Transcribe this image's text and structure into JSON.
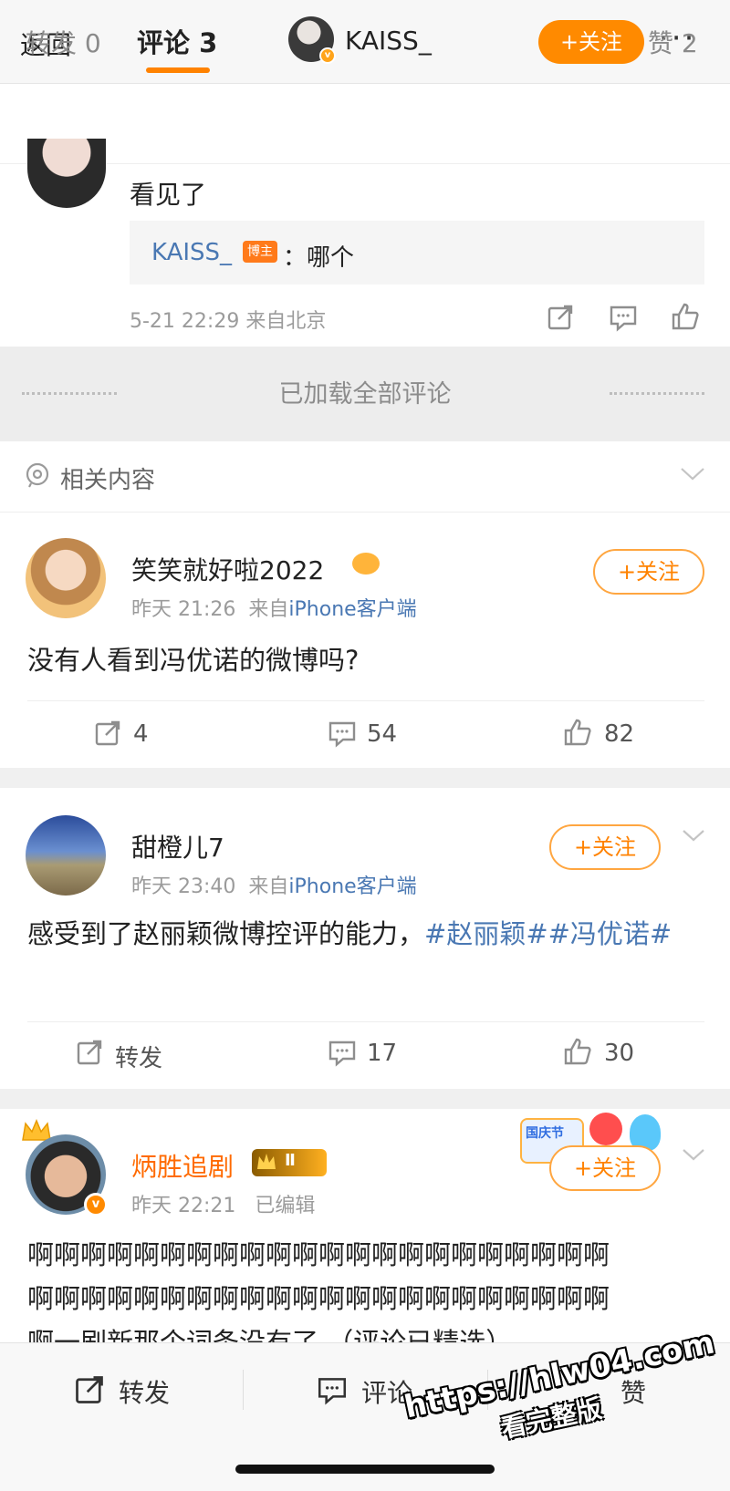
{
  "nav": {
    "back_label": "返回",
    "username": "KAISS_",
    "follow_label": "+关注",
    "more_label": "···"
  },
  "tabs": {
    "repost_label": "转发",
    "repost_count": "0",
    "comment_label": "评论",
    "comment_count": "3",
    "like_label": "赞",
    "like_count": "2"
  },
  "top_comment": {
    "text": "看见了",
    "reply_author": "KAISS_",
    "reply_tag": "博主",
    "reply_text": "：哪个",
    "meta": "5-21 22:29  来自北京"
  },
  "loaded_all": "已加载全部评论",
  "related_title": "相关内容",
  "posts": [
    {
      "author": "笑笑就好啦2022",
      "time": "昨天 21:26",
      "source_prefix": "来自",
      "source": "iPhone客户端",
      "follow_label": "+关注",
      "text": "没有人看到冯优诺的微博吗?",
      "repost": "4",
      "comments": "54",
      "likes": "82"
    },
    {
      "author": "甜橙儿7",
      "time": "昨天 23:40",
      "source_prefix": "来自",
      "source": "iPhone客户端",
      "follow_label": "+关注",
      "text": "感受到了赵丽颖微博控评的能力，",
      "topic1": "#赵丽颖#",
      "topic2": "#冯优诺#",
      "repost": "转发",
      "comments": "17",
      "likes": "30"
    },
    {
      "author": "炳胜追剧",
      "level": "Ⅱ",
      "time": "昨天 22:21",
      "edited": "已编辑",
      "follow_label": "+关注",
      "line1": "啊啊啊啊啊啊啊啊啊啊啊啊啊啊啊啊啊啊啊啊啊啊",
      "line2": "啊啊啊啊啊啊啊啊啊啊啊啊啊啊啊啊啊啊啊啊啊啊",
      "line3": "啊一刷新那个词条没有了   （评论已精选）",
      "badge_text": "国庆节"
    }
  ],
  "bottom": {
    "repost_label": "转发",
    "comment_label": "评论",
    "like_label": "赞"
  },
  "watermark": {
    "url": "https://hlw04.com",
    "caption": "看完整版"
  },
  "colors": {
    "accent": "#ff8200",
    "link": "#4a78b3"
  }
}
